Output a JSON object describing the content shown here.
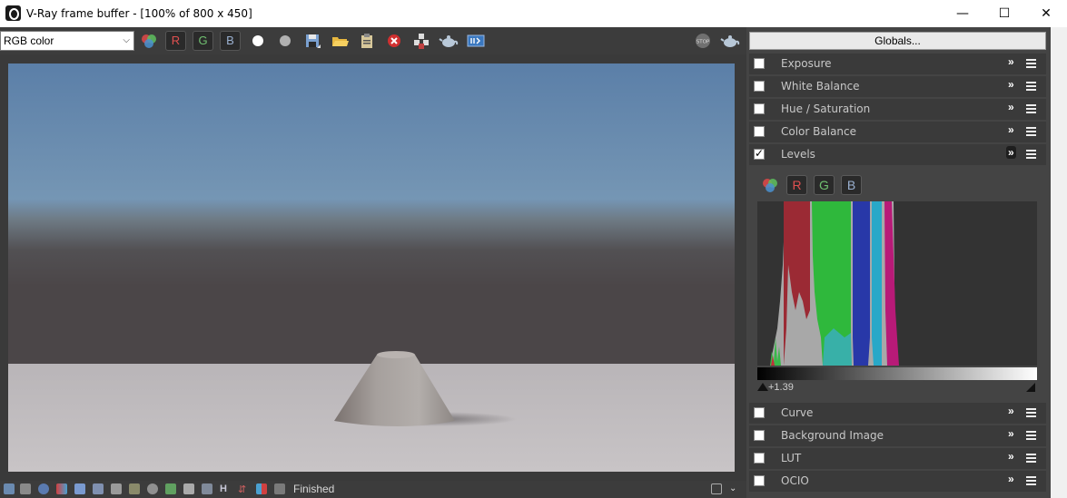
{
  "window": {
    "title": "V-Ray frame buffer - [100% of 800 x 450]"
  },
  "toolbar": {
    "channel_select": "RGB color",
    "red_label": "R",
    "green_label": "G",
    "blue_label": "B",
    "icons": [
      "color-channels-icon",
      "red-channel",
      "green-channel",
      "blue-channel",
      "white-point-icon",
      "gray-point-icon",
      "save-image-icon",
      "open-image-icon",
      "clear-image-icon",
      "stop-clear-icon",
      "region-render-icon",
      "teapot-icon",
      "history-icon",
      "stop-render-icon",
      "render-teapot-icon"
    ]
  },
  "panel": {
    "globals_label": "Globals...",
    "layers": [
      {
        "label": "Exposure",
        "checked": false
      },
      {
        "label": "White Balance",
        "checked": false
      },
      {
        "label": "Hue / Saturation",
        "checked": false
      },
      {
        "label": "Color Balance",
        "checked": false
      },
      {
        "label": "Levels",
        "checked": true
      }
    ],
    "levels": {
      "red_label": "R",
      "green_label": "G",
      "blue_label": "B",
      "value": "+1.39"
    },
    "layers_bottom": [
      {
        "label": "Curve",
        "checked": false
      },
      {
        "label": "Background Image",
        "checked": false
      },
      {
        "label": "LUT",
        "checked": false
      },
      {
        "label": "OCIO",
        "checked": false
      }
    ]
  },
  "status": {
    "text": "Finished"
  },
  "colors": {
    "accent_red": "#e04848",
    "accent_green": "#5ec05e",
    "accent_blue": "#4a90d0",
    "panel_bg": "#444444"
  }
}
